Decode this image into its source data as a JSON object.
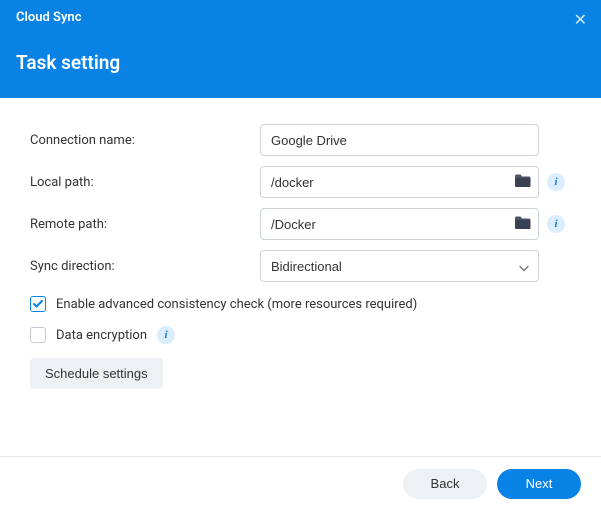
{
  "header": {
    "app_title": "Cloud Sync",
    "page_title": "Task setting"
  },
  "form": {
    "connection_name_label": "Connection name:",
    "connection_name_value": "Google Drive",
    "local_path_label": "Local path:",
    "local_path_value": "/docker",
    "remote_path_label": "Remote path:",
    "remote_path_value": "/Docker",
    "sync_direction_label": "Sync direction:",
    "sync_direction_value": "Bidirectional",
    "consistency_check_label": "Enable advanced consistency check (more resources required)",
    "consistency_check_checked": true,
    "data_encryption_label": "Data encryption",
    "data_encryption_checked": false,
    "schedule_settings_label": "Schedule settings"
  },
  "footer": {
    "back_label": "Back",
    "next_label": "Next"
  },
  "colors": {
    "primary": "#0882e5"
  }
}
